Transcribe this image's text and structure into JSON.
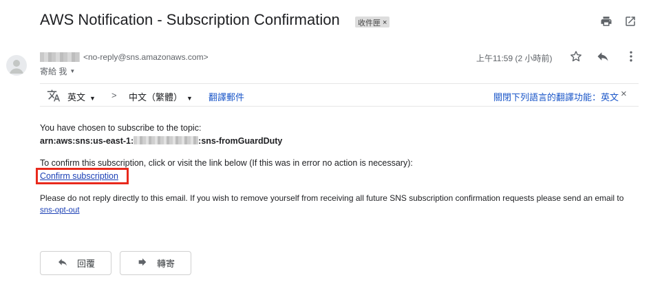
{
  "header": {
    "subject": "AWS Notification - Subscription Confirmation",
    "label": "收件匣",
    "label_close": "×"
  },
  "sender": {
    "email": "<no-reply@sns.amazonaws.com>",
    "to_me": "寄給 我",
    "time": "上午11:59 (2 小時前)"
  },
  "translate": {
    "from_lang": "英文",
    "arrow": ">",
    "to_lang": "中文（繁體）",
    "translate_link": "翻譯郵件",
    "turn_off": "關閉下列語言的翻譯功能：英文",
    "close": "×"
  },
  "message": {
    "line1": "You have chosen to subscribe to the topic:",
    "arn_prefix": "arn:aws:sns:us-east-1:",
    "arn_suffix": ":sns-fromGuardDuty",
    "line2": "To confirm this subscription, click or visit the link below (If this was in error no action is necessary):",
    "confirm_link": "Confirm subscription",
    "line3": "Please do not reply directly to this email. If you wish to remove yourself from receiving all future SNS subscription confirmation requests please send an email to",
    "optout_link": "sns-opt-out"
  },
  "actions": {
    "reply": "回覆",
    "forward": "轉寄"
  },
  "colors": {
    "highlight_border": "#e8291c",
    "link": "#1a3fb5"
  }
}
